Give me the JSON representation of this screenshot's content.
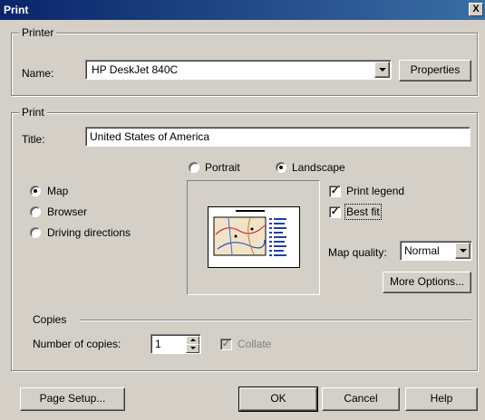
{
  "window": {
    "title": "Print",
    "close_glyph": "X"
  },
  "printer": {
    "group_label": "Printer",
    "name_label": "Name:",
    "name_value": "HP DeskJet 840C",
    "properties_label": "Properties"
  },
  "print": {
    "group_label": "Print",
    "title_label": "Title:",
    "title_value": "United States of America",
    "orientation": {
      "portrait": "Portrait",
      "landscape": "Landscape",
      "selected": "landscape"
    },
    "modes": [
      {
        "label": "Map",
        "selected": true
      },
      {
        "label": "Browser",
        "selected": false
      },
      {
        "label": "Driving directions",
        "selected": false
      }
    ],
    "print_legend": {
      "label": "Print legend",
      "checked": true
    },
    "best_fit": {
      "label": "Best fit",
      "checked": true
    },
    "map_quality": {
      "label": "Map quality:",
      "value": "Normal"
    },
    "more_options_label": "More Options..."
  },
  "copies": {
    "group_label": "Copies",
    "number_label": "Number of copies:",
    "value": "1",
    "collate_label": "Collate",
    "collate_checked": true
  },
  "buttons": {
    "page_setup": "Page Setup...",
    "ok": "OK",
    "cancel": "Cancel",
    "help": "Help"
  }
}
